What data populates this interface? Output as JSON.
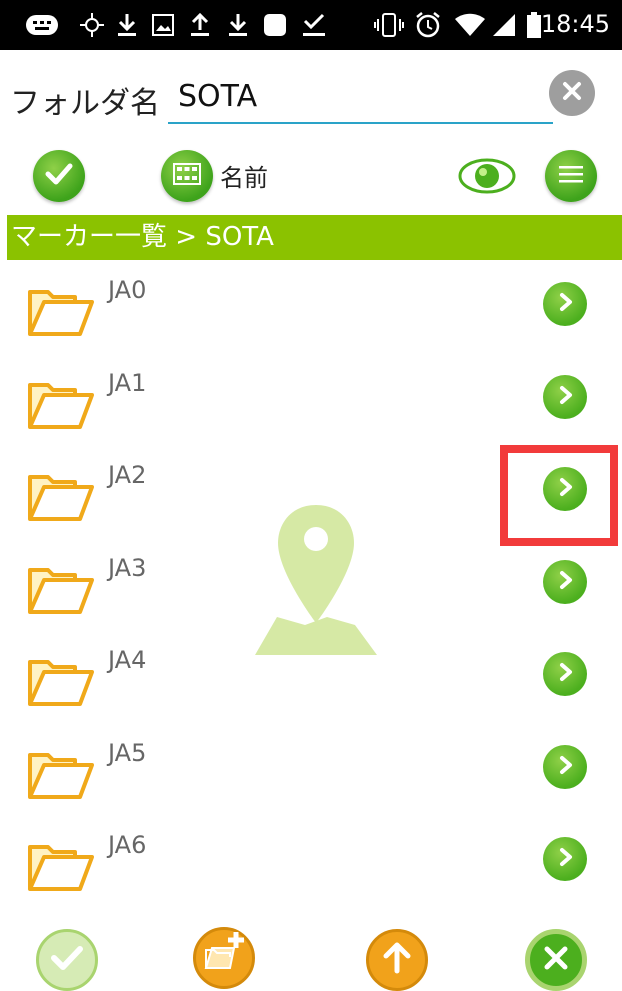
{
  "status_bar": {
    "time": "18:45",
    "icons": [
      "keyboard-icon",
      "crosshair-icon",
      "download-icon",
      "image-icon",
      "upload-icon",
      "download-icon",
      "square-icon",
      "checkbox-download-icon",
      "vibrate-icon",
      "alarm-icon",
      "wifi-icon",
      "signal-icon",
      "battery-icon"
    ]
  },
  "header": {
    "folder_label": "フォルダ名",
    "folder_value": "SOTA",
    "clear_icon": "close-icon"
  },
  "toolbar": {
    "sort_label": "名前",
    "icons": [
      "check-icon",
      "grid-icon",
      "eye-icon",
      "menu-icon"
    ]
  },
  "title_bar": {
    "text": "マーカー一覧 > SOTA"
  },
  "folders": [
    {
      "name": "JA0"
    },
    {
      "name": "JA1"
    },
    {
      "name": "JA2"
    },
    {
      "name": "JA3"
    },
    {
      "name": "JA4"
    },
    {
      "name": "JA5"
    },
    {
      "name": "JA6"
    }
  ],
  "bottom_bar": {
    "icons": [
      "check-icon",
      "new-folder-icon",
      "up-arrow-icon",
      "cancel-icon"
    ]
  },
  "colors": {
    "green": "#8bc200",
    "button_green": "#4caf1e",
    "orange": "#f1a21b",
    "highlight": "#f23b3b"
  }
}
